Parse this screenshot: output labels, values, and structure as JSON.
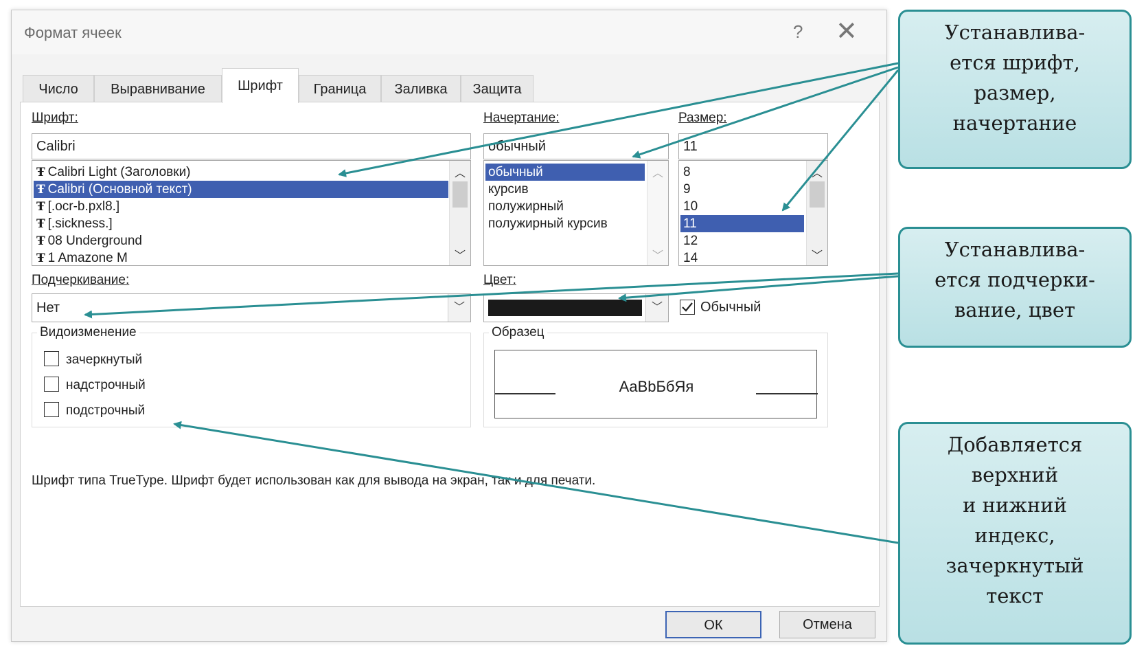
{
  "dialog": {
    "title": "Формат ячеек",
    "help": "?",
    "close": "✕",
    "tabs": [
      "Число",
      "Выравнивание",
      "Шрифт",
      "Граница",
      "Заливка",
      "Защита"
    ],
    "active_tab": "Шрифт"
  },
  "font": {
    "label": "Шрифт:",
    "value": "Calibri",
    "list": [
      "Calibri Light (Заголовки)",
      "Calibri (Основной текст)",
      "[.ocr-b.pxl8.]",
      "[.sickness.]",
      "08 Underground",
      "1 Amazone M"
    ],
    "selected_index": 1,
    "tt_glyph": "Ŧ"
  },
  "style": {
    "label": "Начертание:",
    "value": "обычный",
    "list": [
      "обычный",
      "курсив",
      "полужирный",
      "полужирный курсив"
    ],
    "selected_index": 0
  },
  "size": {
    "label": "Размер:",
    "value": "11",
    "list": [
      "8",
      "9",
      "10",
      "11",
      "12",
      "14"
    ],
    "selected_index": 3
  },
  "underline": {
    "label": "Подчеркивание:",
    "value": "Нет"
  },
  "color": {
    "label": "Цвет:",
    "swatch": "#1a1a1a",
    "normal_label": "Обычный",
    "normal_checked": true
  },
  "effects": {
    "label": "Видоизменение",
    "items": [
      "зачеркнутый",
      "надстрочный",
      "подстрочный"
    ]
  },
  "preview": {
    "label": "Образец",
    "sample": "AaBbБбЯя"
  },
  "info_text": "Шрифт типа TrueType. Шрифт будет использован как для вывода на экран, так и для печати.",
  "buttons": {
    "ok": "ОК",
    "cancel": "Отмена"
  },
  "callouts": [
    {
      "lines": [
        "Устанавлива-",
        "ется шрифт,",
        "размер,",
        "начертание"
      ]
    },
    {
      "lines": [
        "Устанавлива-",
        "ется подчерки-",
        "вание, цвет"
      ]
    },
    {
      "lines": [
        "Добавляется",
        "верхний",
        "и нижний",
        "индекс,",
        "зачеркнутый",
        "текст"
      ]
    }
  ],
  "colors": {
    "accent": "#2a8f93",
    "selection": "#3f5fb0",
    "callout_bg": "#c9e8ea"
  }
}
